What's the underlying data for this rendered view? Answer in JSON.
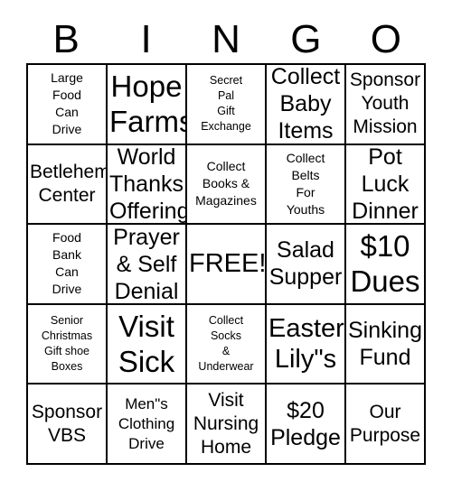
{
  "card": {
    "header_letters": [
      "B",
      "I",
      "N",
      "G",
      "O"
    ],
    "rows": [
      [
        {
          "text": "Large\nFood\nCan\nDrive",
          "size": "fs-sm",
          "free": false
        },
        {
          "text": "Hope\nFarms",
          "size": "fs-3xl",
          "free": false
        },
        {
          "text": "Secret\nPal\nGift\nExchange",
          "size": "fs-xs",
          "free": false
        },
        {
          "text": "Collect\nBaby\nItems",
          "size": "fs-xl",
          "free": false
        },
        {
          "text": "Sponsor\nYouth\nMission",
          "size": "fs-lg",
          "free": false
        }
      ],
      [
        {
          "text": "Betlehem\nCenter",
          "size": "fs-lg",
          "free": false
        },
        {
          "text": "World\nThanks\nOffering",
          "size": "fs-xl",
          "free": false
        },
        {
          "text": "Collect\nBooks &\nMagazines",
          "size": "fs-sm",
          "free": false
        },
        {
          "text": "Collect\nBelts\nFor\nYouths",
          "size": "fs-sm",
          "free": false
        },
        {
          "text": "Pot\nLuck\nDinner",
          "size": "fs-xl",
          "free": false
        }
      ],
      [
        {
          "text": "Food\nBank\nCan\nDrive",
          "size": "fs-sm",
          "free": false
        },
        {
          "text": "Prayer\n& Self\nDenial",
          "size": "fs-xl",
          "free": false
        },
        {
          "text": "FREE!",
          "size": "fs-2xl",
          "free": true
        },
        {
          "text": "Salad\nSupper",
          "size": "fs-xl",
          "free": false
        },
        {
          "text": "$10\nDues",
          "size": "fs-3xl",
          "free": false
        }
      ],
      [
        {
          "text": "Senior\nChristmas\nGift shoe\nBoxes",
          "size": "fs-xs",
          "free": false
        },
        {
          "text": "Visit\nSick",
          "size": "fs-3xl",
          "free": false
        },
        {
          "text": "Collect\nSocks\n&\nUnderwear",
          "size": "fs-xs",
          "free": false
        },
        {
          "text": "Easter\nLily\"s",
          "size": "fs-2xl",
          "free": false
        },
        {
          "text": "Sinking\nFund",
          "size": "fs-xl",
          "free": false
        }
      ],
      [
        {
          "text": "Sponsor\nVBS",
          "size": "fs-lg",
          "free": false
        },
        {
          "text": "Men\"s\nClothing\nDrive",
          "size": "fs-md",
          "free": false
        },
        {
          "text": "Visit\nNursing\nHome",
          "size": "fs-lg",
          "free": false
        },
        {
          "text": "$20\nPledge",
          "size": "fs-xl",
          "free": false
        },
        {
          "text": "Our\nPurpose",
          "size": "fs-lg",
          "free": false
        }
      ]
    ],
    "colors": {
      "border": "#000000",
      "background": "#ffffff",
      "text": "#000000"
    }
  }
}
